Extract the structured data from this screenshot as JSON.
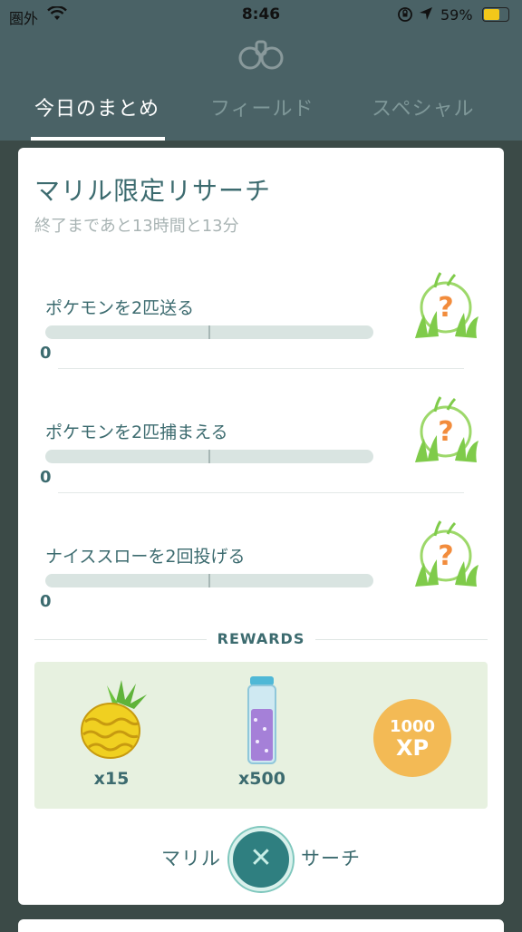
{
  "status_bar": {
    "carrier": "圏外",
    "time": "8:46",
    "battery_pct": "59%",
    "battery_level": 0.59
  },
  "header": {
    "tabs": [
      {
        "label": "今日のまとめ",
        "active": true
      },
      {
        "label": "フィールド",
        "active": false
      },
      {
        "label": "スペシャル",
        "active": false
      }
    ]
  },
  "card": {
    "title": "マリル限定リサーチ",
    "subtitle": "終了まであと13時間と13分",
    "tasks": [
      {
        "label": "ポケモンを2匹送る",
        "count": "0",
        "progress": 0
      },
      {
        "label": "ポケモンを2匹捕まえる",
        "count": "0",
        "progress": 0
      },
      {
        "label": "ナイススローを2回投げる",
        "count": "0",
        "progress": 0
      }
    ],
    "task_reward_symbol": "?",
    "rewards_heading": "REWARDS",
    "rewards": [
      {
        "icon": "pinap-berry-icon",
        "qty": "x15"
      },
      {
        "icon": "stardust-icon",
        "qty": "x500"
      },
      {
        "icon": "xp-badge",
        "amount": "1000",
        "unit": "XP"
      }
    ],
    "footer_text": "マリル　　　　サーチ",
    "close_symbol": "✕"
  },
  "colors": {
    "header_bg": "#4a6266",
    "accent": "#3c6b6f",
    "rewards_bg": "#e7f1e0",
    "xp_badge": "#f3ba55",
    "question_mark": "#f28c3c",
    "close_button": "#2f7f80"
  }
}
